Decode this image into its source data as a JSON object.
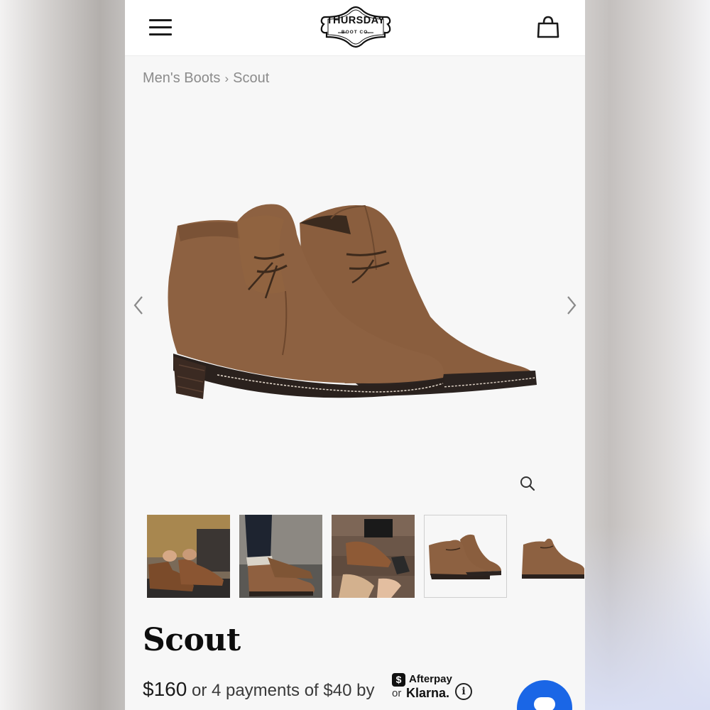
{
  "header": {
    "menu_icon": "hamburger-menu-icon",
    "logo_text": "THURSDAY",
    "logo_subtext": "BOOT CO.",
    "bag_icon": "shopping-bag-icon"
  },
  "breadcrumb": {
    "items": [
      "Men's Boots",
      "Scout"
    ],
    "separator": "›"
  },
  "gallery": {
    "main_image": "brown suede chukka boots pair",
    "prev_icon": "chevron-left-icon",
    "next_icon": "chevron-right-icon",
    "zoom_icon": "magnifier-icon",
    "thumbnails": [
      {
        "name": "boots-on-feet-tying-laces",
        "selected": false
      },
      {
        "name": "boots-with-dark-jeans",
        "selected": false
      },
      {
        "name": "unboxing-boots-on-wood",
        "selected": false
      },
      {
        "name": "boots-pair-side-view",
        "selected": true
      },
      {
        "name": "single-boot-side",
        "selected": false
      }
    ]
  },
  "product": {
    "title": "Scout",
    "price": "$160",
    "installments_text": " or 4 payments of $40 by",
    "afterpay_label": "Afterpay",
    "afterpay_symbol": "$",
    "or_label": "or",
    "klarna_label": "Klarna.",
    "info_symbol": "i"
  },
  "colors": {
    "suede": "#8a5c3c",
    "chat_button": "#1a66e6",
    "breadcrumb_text": "#8b8b8b"
  }
}
